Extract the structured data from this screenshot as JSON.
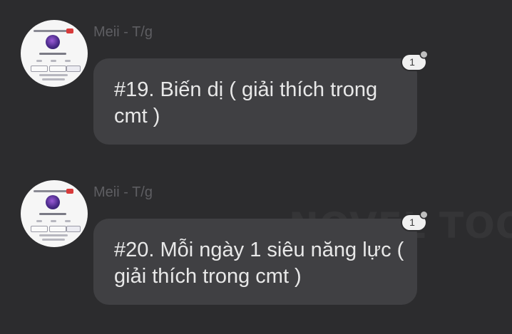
{
  "watermark": "NOVEL TOON",
  "messages": [
    {
      "sender": "Meii - T/g",
      "text": "#19. Biến dị ( giải thích trong cmt )",
      "reaction_count": "1"
    },
    {
      "sender": "Meii - T/g",
      "text": "#20. Mỗi ngày 1 siêu năng lực ( giải thích trong cmt )",
      "reaction_count": "1"
    }
  ],
  "colors": {
    "background": "#2c2c2e",
    "bubble": "#404043",
    "message_text": "#e8e8e8",
    "sender_text": "#5e5e62",
    "badge": "#f0f0f0"
  },
  "icons": {
    "reaction": "reaction-icon",
    "avatar": "avatar-image"
  }
}
